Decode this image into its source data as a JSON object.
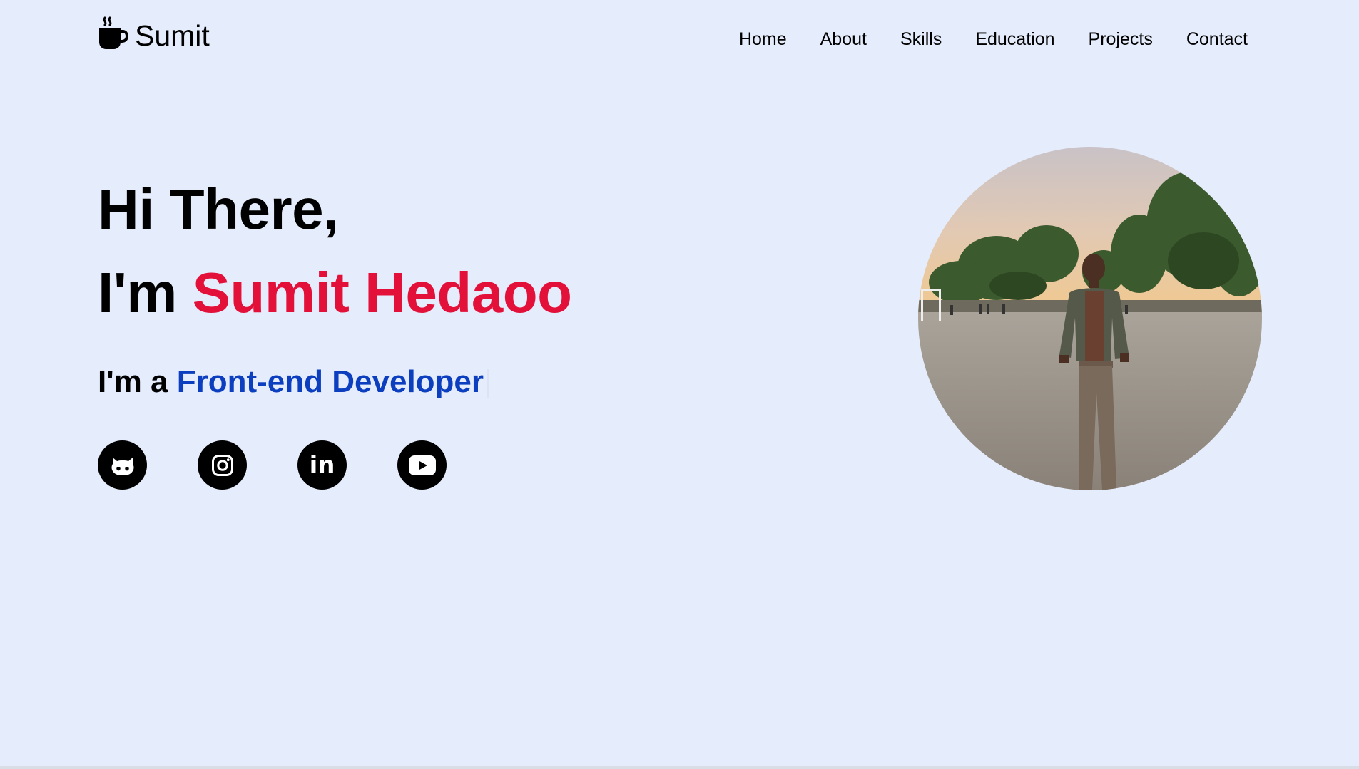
{
  "brand": {
    "name": "Sumit",
    "icon": "coffee-cup-icon"
  },
  "nav": {
    "items": [
      {
        "label": "Home"
      },
      {
        "label": "About"
      },
      {
        "label": "Skills"
      },
      {
        "label": "Education"
      },
      {
        "label": "Projects"
      },
      {
        "label": "Contact"
      }
    ]
  },
  "hero": {
    "greeting": "Hi There,",
    "intro": "I'm",
    "name": "Sumit Hedaoo",
    "role_prefix": "I'm a",
    "role": "Front-end Developer"
  },
  "socials": [
    {
      "icon": "github-icon"
    },
    {
      "icon": "instagram-icon"
    },
    {
      "icon": "linkedin-icon",
      "text": "in"
    },
    {
      "icon": "youtube-icon"
    }
  ],
  "colors": {
    "background": "#e5ecfb",
    "name_accent": "#e3103a",
    "role_accent": "#0b3fc0",
    "text": "#000000"
  }
}
